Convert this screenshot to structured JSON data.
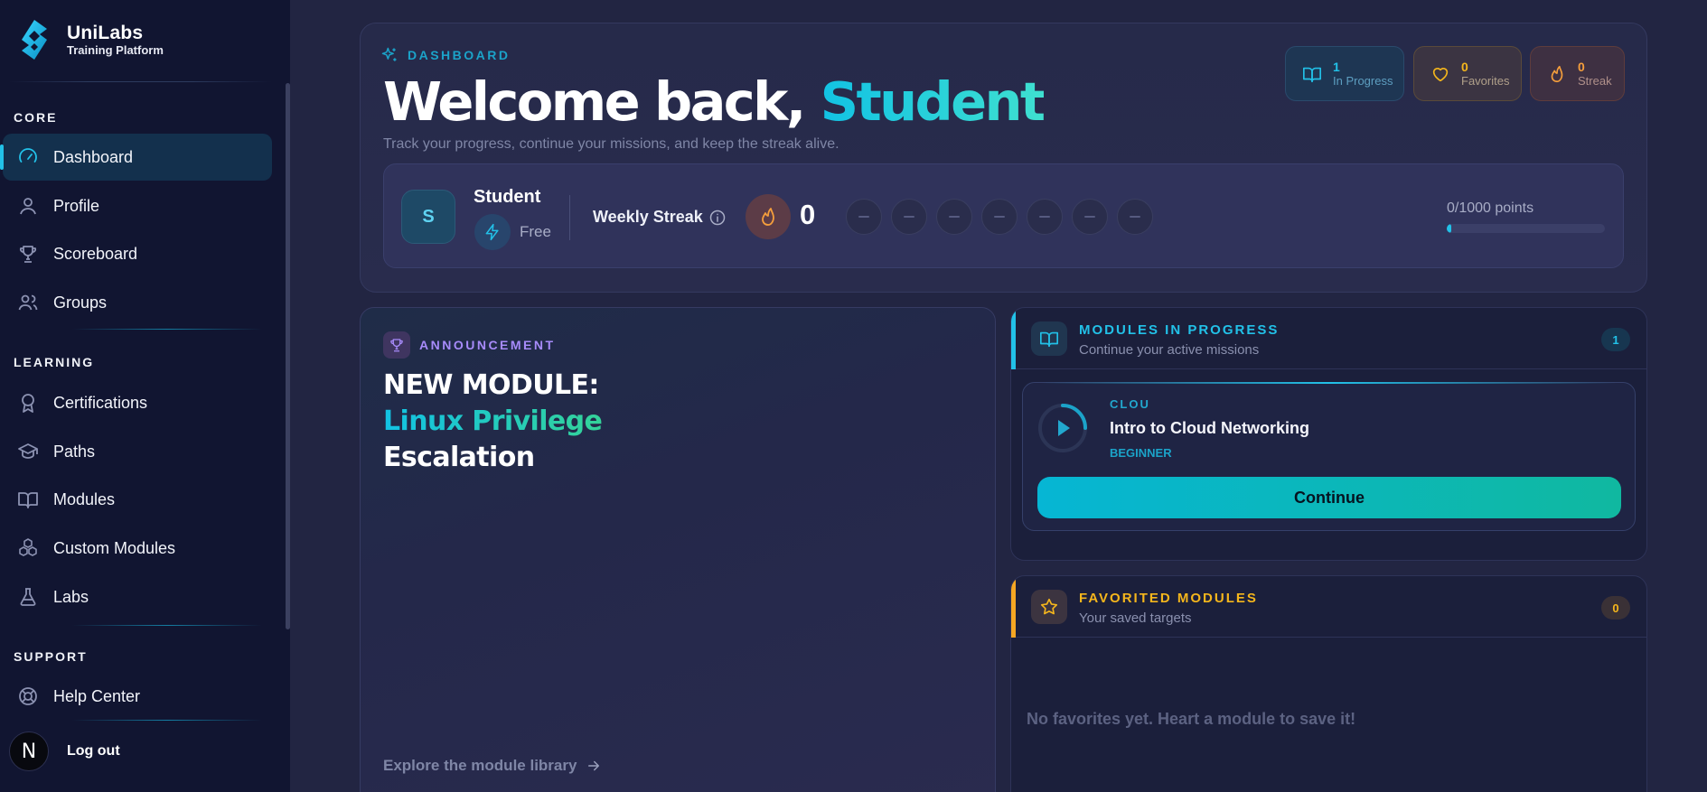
{
  "brand": {
    "name": "UniLabs",
    "subtitle": "Training Platform"
  },
  "sidebar": {
    "sections": [
      {
        "title": "CORE",
        "items": [
          {
            "label": "Dashboard",
            "icon": "gauge-icon",
            "active": true
          },
          {
            "label": "Profile",
            "icon": "user-icon"
          },
          {
            "label": "Scoreboard",
            "icon": "trophy-icon"
          },
          {
            "label": "Groups",
            "icon": "users-icon"
          }
        ]
      },
      {
        "title": "LEARNING",
        "items": [
          {
            "label": "Certifications",
            "icon": "award-icon"
          },
          {
            "label": "Paths",
            "icon": "graduation-cap-icon"
          },
          {
            "label": "Modules",
            "icon": "book-open-icon"
          },
          {
            "label": "Custom Modules",
            "icon": "boxes-icon"
          },
          {
            "label": "Labs",
            "icon": "flask-icon"
          }
        ]
      },
      {
        "title": "SUPPORT",
        "items": [
          {
            "label": "Help Center",
            "icon": "life-buoy-icon"
          }
        ]
      }
    ],
    "logout": {
      "avatar_letter": "N",
      "label": "Log out"
    }
  },
  "hero": {
    "tag": "DASHBOARD",
    "greeting": "Welcome back, ",
    "name": "Student",
    "subtitle": "Track your progress, continue your missions, and keep the streak alive.",
    "stats": [
      {
        "value": "1",
        "label": "In Progress",
        "icon": "book-open-icon",
        "color": "#22c1e8"
      },
      {
        "value": "0",
        "label": "Favorites",
        "icon": "heart-icon",
        "color": "#f5b61c"
      },
      {
        "value": "0",
        "label": "Streak",
        "icon": "flame-icon",
        "color": "#f59e3c"
      }
    ]
  },
  "profile": {
    "avatar_letter": "S",
    "name": "Student",
    "plan": "Free",
    "streak_label": "Weekly Streak",
    "streak_count": "0",
    "week_days_completed": 0,
    "points_text": "0/1000 points",
    "points_progress": 0
  },
  "announcement": {
    "tag": "ANNOUNCEMENT",
    "title_line1": "NEW MODULE:",
    "title_line2": "Linux Privilege",
    "title_line3": "Escalation",
    "link": "Explore the module library"
  },
  "in_progress": {
    "title": "MODULES IN PROGRESS",
    "subtitle": "Continue your active missions",
    "count": "1",
    "accent": "#22c1e8",
    "module": {
      "category": "CLOU",
      "title": "Intro to Cloud Networking",
      "level": "BEGINNER",
      "button": "Continue"
    }
  },
  "favorites": {
    "title": "FAVORITED MODULES",
    "subtitle": "Your saved targets",
    "count": "0",
    "accent": "#f5b61c",
    "empty": "No favorites yet. Heart a module to save it!"
  }
}
